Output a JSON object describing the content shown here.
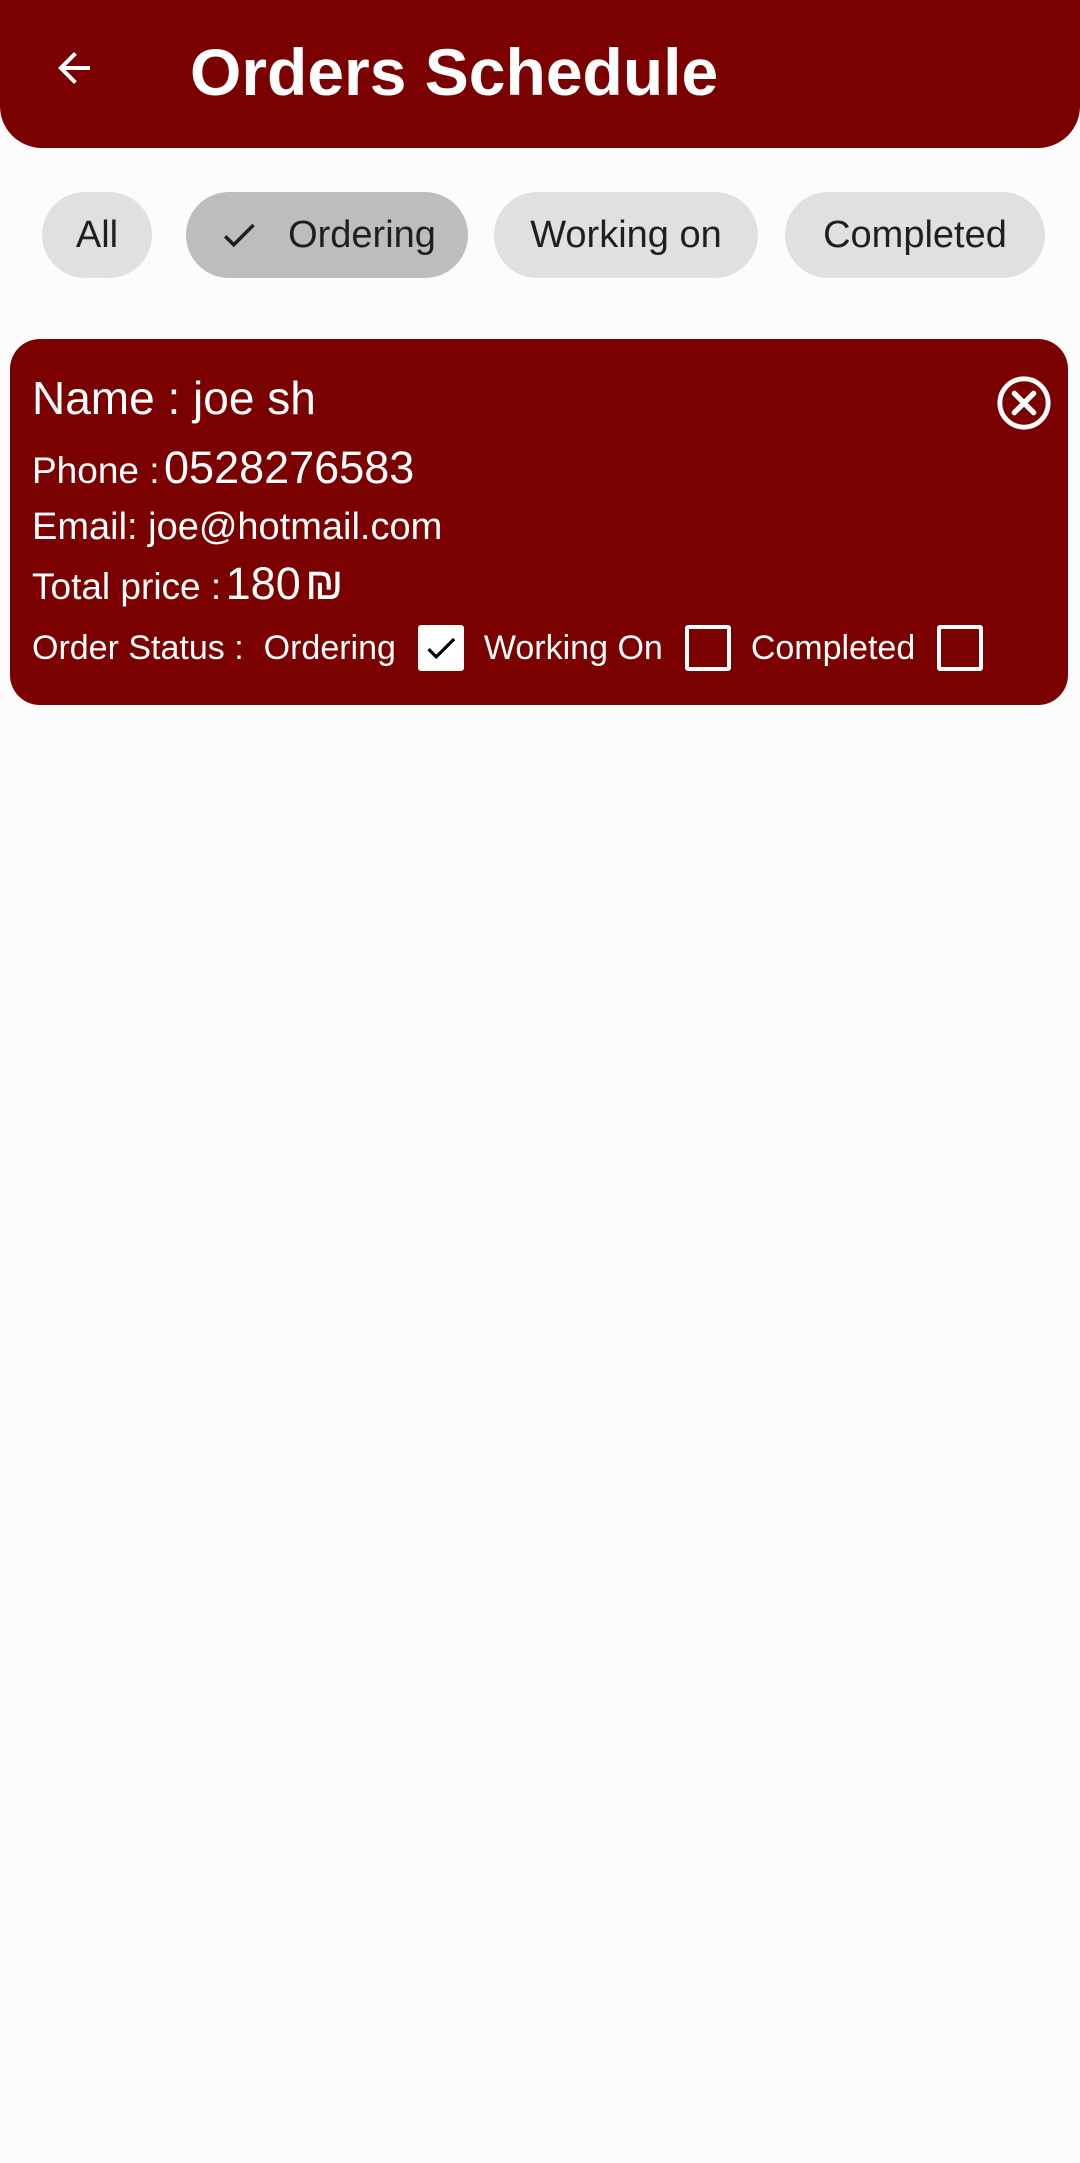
{
  "app_bar": {
    "title": "Orders Schedule",
    "back_icon": "arrow-back-icon",
    "background": "#7b0000"
  },
  "filters": [
    {
      "label": "All",
      "selected": false
    },
    {
      "label": "Ordering",
      "selected": true
    },
    {
      "label": "Working on",
      "selected": false
    },
    {
      "label": "Completed",
      "selected": false
    }
  ],
  "orders": [
    {
      "name_label": "Name :",
      "name": "joe sh",
      "phone_label": "Phone :",
      "phone": "0528276583",
      "email_label": "Email:",
      "email": "joe@hotmail.com",
      "price_label": "Total price :",
      "price": "180",
      "currency": "₪",
      "status_label": "Order Status :",
      "statuses": [
        {
          "label": "Ordering",
          "checked": true
        },
        {
          "label": "Working On",
          "checked": false
        },
        {
          "label": "Completed",
          "checked": false
        }
      ],
      "close_icon": "cancel-circle-icon"
    }
  ],
  "colors": {
    "accent": "#7b0000",
    "chip": "#e0e0e0",
    "chip_selected": "#bdbdbd",
    "background": "#fcfcfc"
  }
}
